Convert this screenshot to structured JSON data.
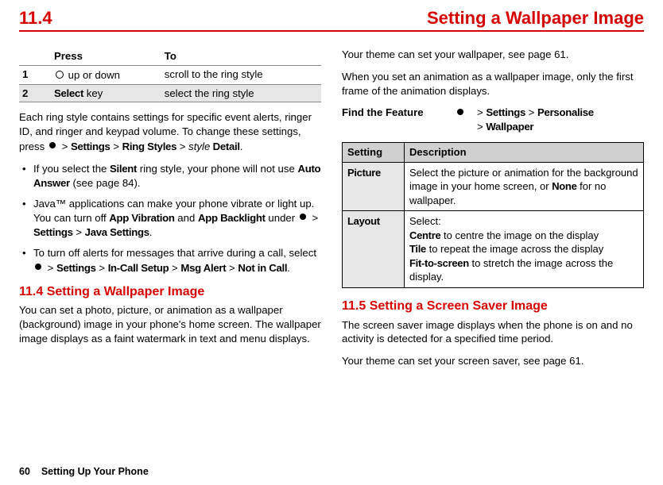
{
  "header": {
    "section_number": "11.4",
    "section_title": "Setting a Wallpaper Image"
  },
  "left": {
    "table_press_to": {
      "head_press": "Press",
      "head_to": "To",
      "row1_num": "1",
      "row1_press": "up or down",
      "row1_to": "scroll to the ring style",
      "row2_num": "2",
      "row2_press_key": "Select",
      "row2_press_suffix": " key",
      "row2_to": "select the ring style"
    },
    "para1_a": "Each ring style contains settings for specific event alerts, ringer ID, and ringer and keypad volume. To change these settings, press ",
    "para1_b": " > ",
    "menu_settings": "Settings",
    "menu_ring_styles": "Ring Styles",
    "menu_style_word": "style",
    "menu_detail": " Detail",
    "para1_end": ".",
    "bullets": {
      "b1_a": "If you select the ",
      "b1_silent": "Silent",
      "b1_b": " ring style, your phone will not use ",
      "b1_auto": "Auto Answer",
      "b1_c": " (see page 84).",
      "b2_a": "Java™ applications can make your phone vibrate or light up. You can turn off ",
      "b2_vib": "App Vibration",
      "b2_and": " and ",
      "b2_bl": "App Backlight",
      "b2_b": " under ",
      "b2_sep": " > ",
      "b2_settings": "Settings",
      "b2_java": "Java Settings",
      "b2_end": ".",
      "b3_a": "To turn off alerts for messages that arrive during a call, select ",
      "b3_sep": " > ",
      "b3_settings": "Settings",
      "b3_incall": "In-Call Setup",
      "b3_msg": "Msg Alert",
      "b3_nic": "Not in Call",
      "b3_end": "."
    },
    "sec_title": "11.4 Setting a Wallpaper Image",
    "sec_para": "You can set a photo, picture, or animation as a wallpaper (background) image in your phone's home screen. The wallpaper image displays as a faint watermark in text and menu displays."
  },
  "right": {
    "para1": "Your theme can set your wallpaper, see page 61.",
    "para2": "When you set an animation as a wallpaper image, only the first frame of the animation displays.",
    "ftf_label": "Find the Feature",
    "ftf_sep": "> ",
    "ftf_settings": "Settings",
    "ftf_pers": "Personalise",
    "ftf_wall": "Wallpaper",
    "table": {
      "head_setting": "Setting",
      "head_desc": "Description",
      "row1_setting": "Picture",
      "row1_desc_a": "Select the picture or animation for the background image in your home screen, or ",
      "row1_none": "None",
      "row1_desc_b": " for no wallpaper.",
      "row2_setting": "Layout",
      "row2_desc_a": "Select:",
      "row2_centre": "Centre",
      "row2_centre_txt": " to centre the image on the display",
      "row2_tile": "Tile",
      "row2_tile_txt": " to repeat the image across the display",
      "row2_fit": "Fit-to-screen",
      "row2_fit_txt": " to stretch the image across the display."
    },
    "sec_title": "11.5 Setting a Screen Saver Image",
    "sec_para1": "The screen saver image displays when the phone is on and no activity is detected for a specified time period.",
    "sec_para2": "Your theme can set your screen saver, see page 61."
  },
  "footer": {
    "page_num": "60",
    "footer_text": "Setting Up Your Phone"
  }
}
